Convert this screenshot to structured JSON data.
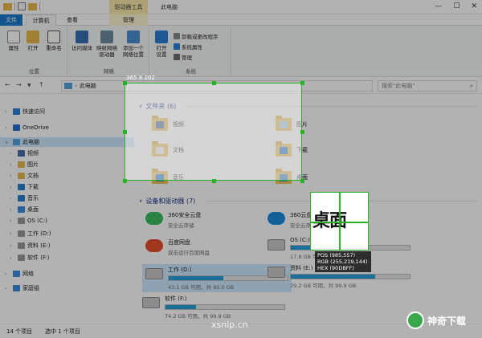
{
  "titlebar": {
    "context_tab": "驱动器工具",
    "title": "此电脑",
    "minimize": "—",
    "maximize": "☐",
    "close": "✕"
  },
  "tabs": {
    "file": "文件",
    "computer": "计算机",
    "view": "查看",
    "manage": "管理"
  },
  "ribbon": {
    "location": {
      "label": "位置",
      "properties": "属性",
      "open": "打开",
      "rename": "重命名"
    },
    "network": {
      "label": "网络",
      "access_media": "访问媒体",
      "map_drive_1": "映射网络",
      "map_drive_2": "驱动器",
      "add_location_1": "添加一个",
      "add_location_2": "网络位置"
    },
    "system": {
      "label": "系统",
      "open_settings_1": "打开",
      "open_settings_2": "设置",
      "uninstall": "卸载或更改程序",
      "system_properties": "系统属性",
      "manage": "管理"
    }
  },
  "address": {
    "path": "此电脑",
    "search_placeholder": "搜索\"此电脑\""
  },
  "sidebar": {
    "items": [
      {
        "label": "快速访问",
        "color": "#2a7fd4"
      },
      {
        "label": "OneDrive",
        "color": "#2a6fd0"
      },
      {
        "label": "此电脑",
        "color": "#5a9fd8"
      },
      {
        "label": "视频",
        "color": "#4b6ea8"
      },
      {
        "label": "图片",
        "color": "#e8b84a"
      },
      {
        "label": "文档",
        "color": "#e8b84a"
      },
      {
        "label": "下载",
        "color": "#2a7fd4"
      },
      {
        "label": "音乐",
        "color": "#2a7fd4"
      },
      {
        "label": "桌面",
        "color": "#3c8dde"
      },
      {
        "label": "OS (C:)",
        "color": "#9a9a9a"
      },
      {
        "label": "工作 (D:)",
        "color": "#9a9a9a"
      },
      {
        "label": "资料 (E:)",
        "color": "#9a9a9a"
      },
      {
        "label": "软件 (F:)",
        "color": "#9a9a9a"
      },
      {
        "label": "网络",
        "color": "#3c8dde"
      },
      {
        "label": "家庭组",
        "color": "#3c8dde"
      }
    ]
  },
  "content": {
    "folders_header": "文件夹 (6)",
    "folders": [
      {
        "label": "视频",
        "badge": "#4b6ea8"
      },
      {
        "label": "图片",
        "badge": "#b0d6f0"
      },
      {
        "label": "文档",
        "badge": "#f4f4f4"
      },
      {
        "label": "下载",
        "badge": "#2a7fd4"
      },
      {
        "label": "音乐",
        "badge": "#2a7fd4"
      },
      {
        "label": "桌面",
        "badge": "#3c8dde"
      }
    ],
    "devices_header": "设备和驱动器 (7)",
    "cloud": [
      {
        "name": "360安全云盘",
        "sub": "安全云存储",
        "color": "#3dbb61"
      },
      {
        "name": "360云盘",
        "sub": "安全云存储",
        "color": "#1a8be0"
      },
      {
        "name": "百度网盘",
        "sub": "双击运行百度网盘",
        "color": "#e8502f"
      }
    ],
    "drives": [
      {
        "name": "OS (C:)",
        "sub": "17.8 GB 可用，共 39.0 GB",
        "used": 0.54
      },
      {
        "name": "工作 (D:)",
        "sub": "43.1 GB 可用，共 80.0 GB",
        "used": 0.46
      },
      {
        "name": "资料 (E:)",
        "sub": "29.2 GB 可用，共 99.9 GB",
        "used": 0.71
      },
      {
        "name": "软件 (F:)",
        "sub": "74.2 GB 可用，共 99.9 GB",
        "used": 0.26
      }
    ]
  },
  "capture": {
    "size_label": "365 X 202",
    "magnifier_text": "桌面",
    "pos": "POS (985,557)",
    "rgb": "RGB (255,219,144)",
    "hex": "HEX (90DBFF)"
  },
  "status": {
    "items": "14 个项目",
    "selected": "选中 1 个项目"
  },
  "watermark": {
    "site": "xsnip.cn",
    "logo": "神奇下载"
  }
}
